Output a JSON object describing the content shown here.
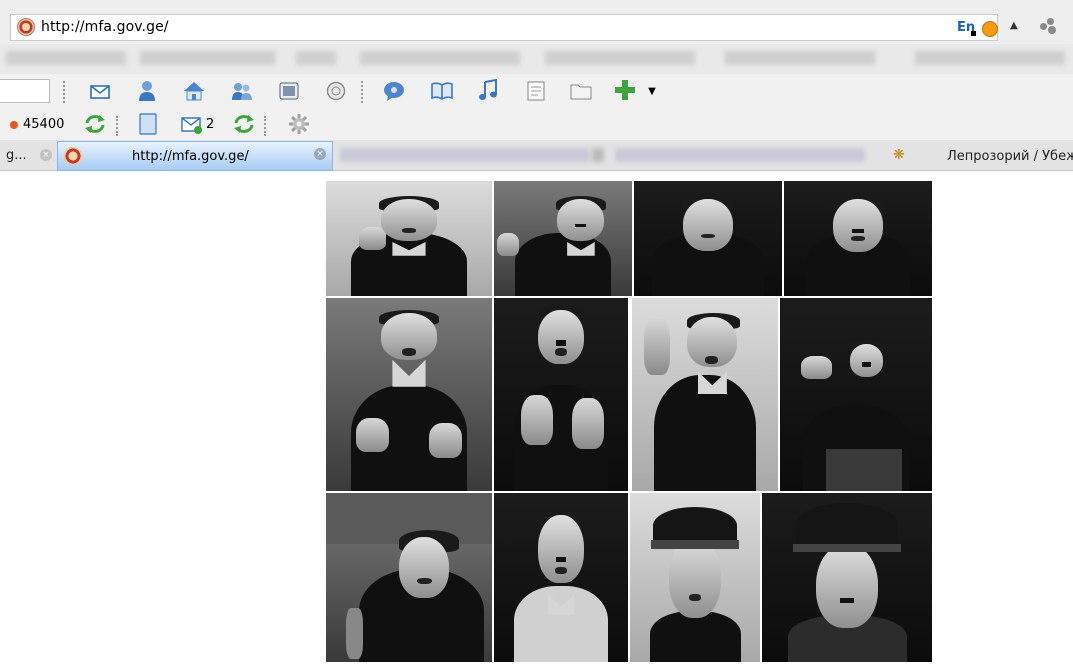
{
  "address_bar": {
    "url": "http://mfa.gov.ge/",
    "lang_indicator": "En"
  },
  "toolbar2": {
    "count": "45400",
    "mail_badge": "2"
  },
  "tabs": {
    "previous_tab_label": "g...",
    "active_tab_title": "http://mfa.gov.ge/",
    "last_tab_title": "Лепрозорий / Убеж"
  },
  "icons": {
    "site": "site-favicon-icon",
    "toolbar": [
      "mail-icon",
      "user-icon",
      "home-icon",
      "users-icon",
      "window-icon",
      "clock-icon",
      "chat-icon",
      "book-icon",
      "music-icon",
      "document-icon",
      "folder-icon",
      "add-icon"
    ],
    "toolbar2": [
      "refresh-icon",
      "page-icon",
      "mail-icon",
      "refresh-icon",
      "settings-icon"
    ]
  },
  "colors": {
    "active_tab": "#a7cbf2",
    "toolbar_bg": "#f1f1f1",
    "accent_green": "#3aa53a"
  },
  "collage": {
    "photo_count": 12
  }
}
